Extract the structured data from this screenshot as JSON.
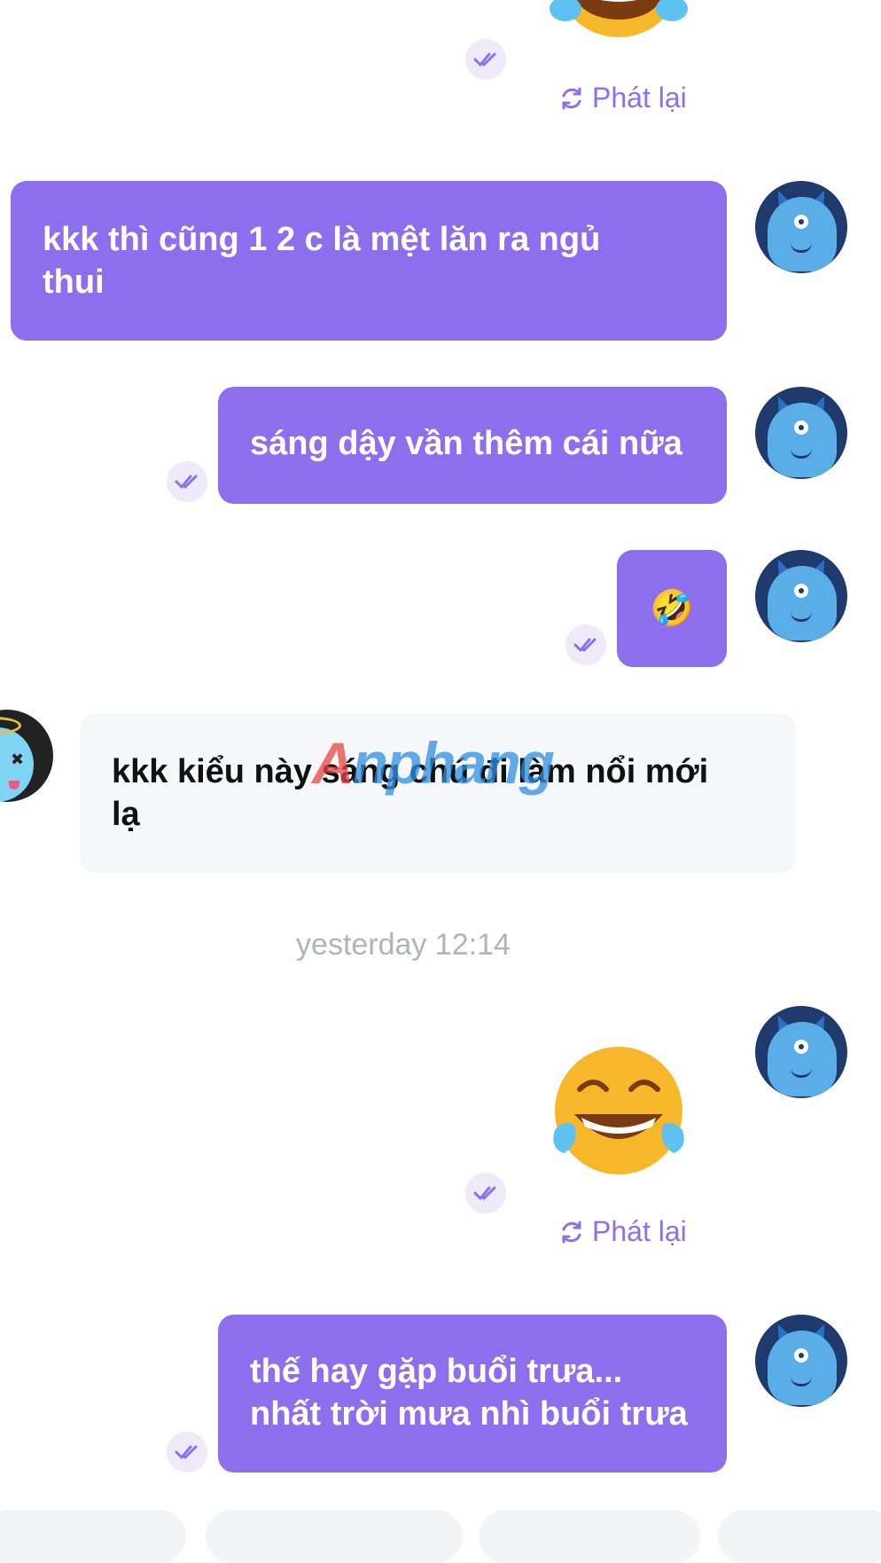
{
  "replay_label": "Phát lại",
  "messages": {
    "m1": "kkk  thì cũng 1 2 c là mệt lăn ra ngủ\nthui",
    "m2": "sáng dậy vần thêm cái nữa",
    "m3": "🤣",
    "m4": "kkk kiểu này sáng chú đi làm nổi mới\nlạ",
    "m5": "thế hay gặp buổi trưa...\nnhất trời mưa nhì buổi trưa"
  },
  "timestamp": "yesterday 12:14",
  "watermark": {
    "part1": "A",
    "part2": "nphang"
  },
  "icons": {
    "read_receipt": "double-check-icon",
    "replay": "refresh-icon",
    "big_emoji": "face-with-tears-of-joy-emoji"
  },
  "colors": {
    "outgoing_bubble": "#8d6fee",
    "incoming_bubble": "#f6f7fa",
    "accent": "#8d6fee",
    "timestamp": "#b0b3b8"
  }
}
